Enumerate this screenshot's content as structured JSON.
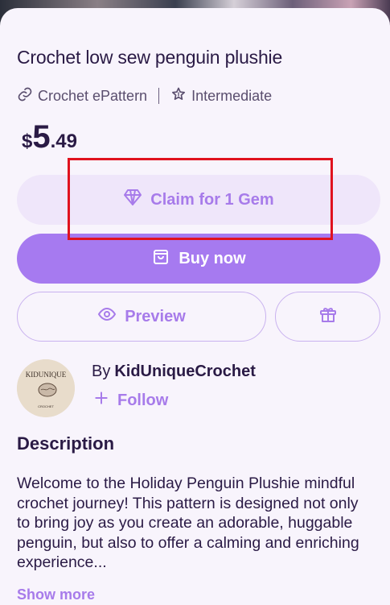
{
  "product": {
    "title": "Crochet low sew penguin plushie",
    "type_label": "Crochet ePattern",
    "level_label": "Intermediate",
    "price": {
      "currency": "$",
      "whole": "5",
      "fraction": ".49"
    }
  },
  "actions": {
    "claim_label": "Claim for 1 Gem",
    "buy_label": "Buy now",
    "preview_label": "Preview"
  },
  "seller": {
    "by_prefix": "By",
    "name": "KidUniqueCrochet",
    "follow_label": "Follow",
    "avatar_text_top": "KIDUNIQUE",
    "avatar_text_bottom": "CROCHET"
  },
  "description": {
    "heading": "Description",
    "body": "Welcome to the Holiday Penguin Plushie mindful crochet journey! This pattern is designed not only to bring joy as you create an adorable, huggable penguin, but also to offer a calming and enriching experience...",
    "show_more_label": "Show more"
  },
  "colors": {
    "accent": "#a67af0",
    "text": "#2a1a45",
    "highlight": "#e0121e"
  }
}
